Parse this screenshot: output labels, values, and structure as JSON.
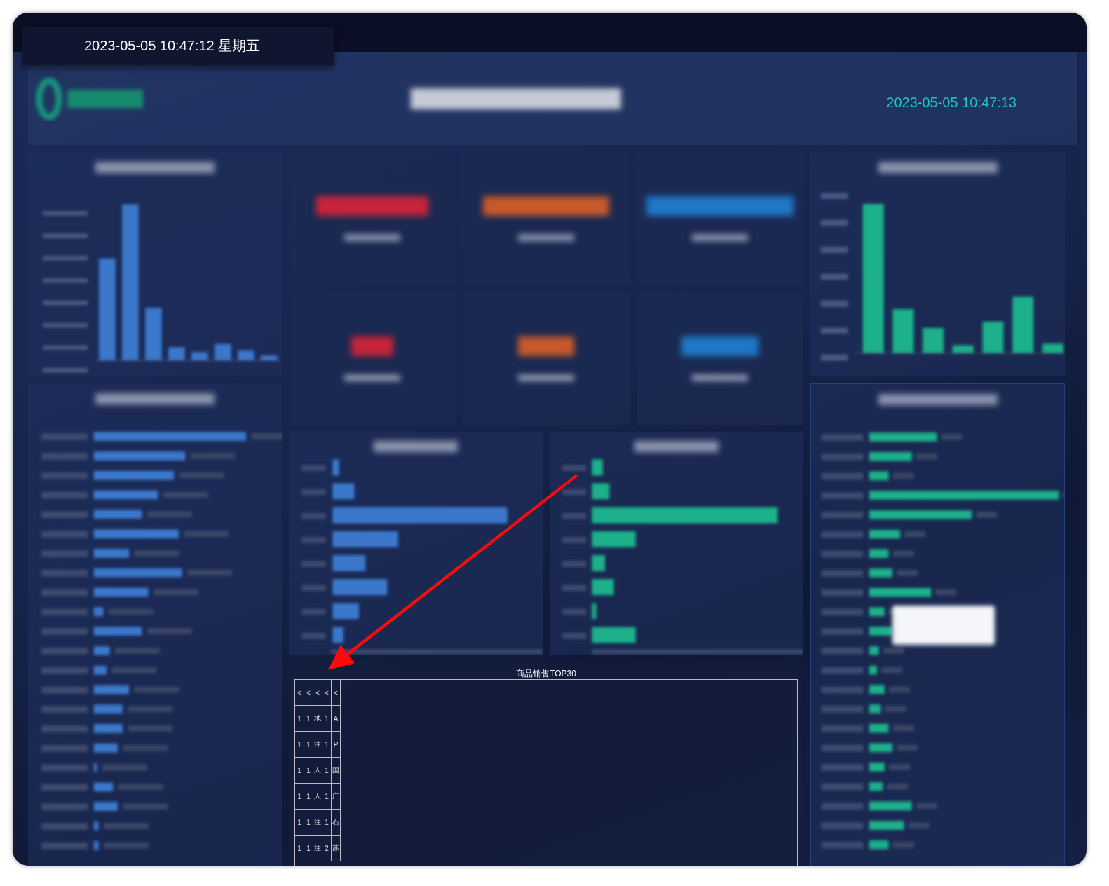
{
  "top_bar": {
    "datetime": "2023-05-05 10:47:12 星期五"
  },
  "header": {
    "clock": "2023-05-05 10:47:13"
  },
  "sales_table": {
    "title": "商品销售TOP30",
    "columns": [
      "<",
      "<",
      "<",
      "<",
      "<"
    ],
    "rows": [
      [
        "1",
        "1",
        "地",
        "1",
        "A"
      ],
      [
        "1",
        "1",
        "注",
        "1",
        "P"
      ],
      [
        "1",
        "1",
        "人",
        "1",
        "国"
      ],
      [
        "1",
        "1",
        "人",
        "1",
        "广"
      ],
      [
        "1",
        "1",
        "注",
        "1",
        "石"
      ],
      [
        "1",
        "1",
        "注",
        "2",
        "苏"
      ]
    ]
  }
}
